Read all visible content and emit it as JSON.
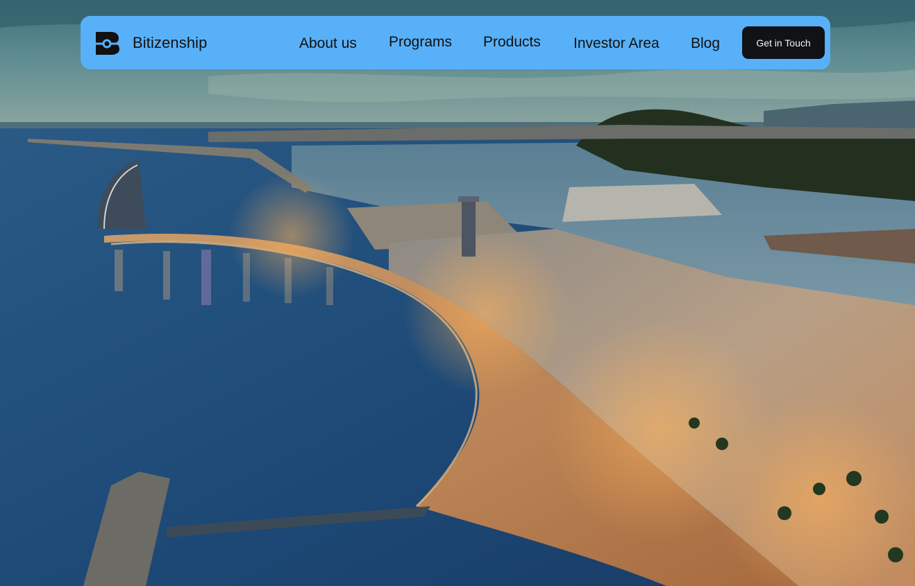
{
  "brand": {
    "name": "Bitizenship",
    "icon": "bitizenship-logo-icon",
    "accent_color": "#58b1f8"
  },
  "nav": {
    "links": [
      {
        "label": "About us"
      },
      {
        "label": "Programs"
      },
      {
        "label": "Products"
      },
      {
        "label": "Investor Area"
      },
      {
        "label": "Blog"
      }
    ],
    "cta_label": "Get in Touch"
  },
  "hero": {
    "image_subject": "aerial-city-coastline-night"
  }
}
